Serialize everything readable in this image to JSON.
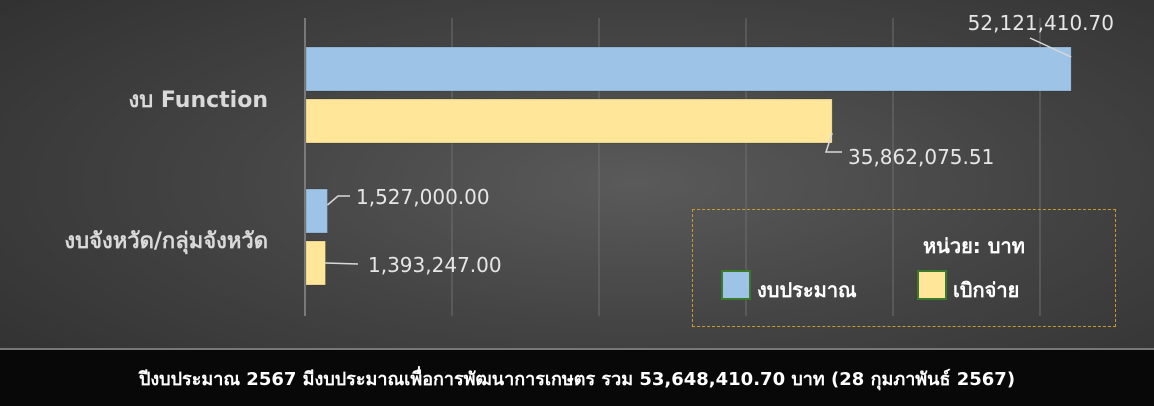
{
  "chart_data": {
    "type": "bar",
    "orientation": "horizontal",
    "categories": [
      "งบ Function",
      "งบจังหวัด/กลุ่มจังหวัด"
    ],
    "series": [
      {
        "name": "งบประมาณ",
        "values": [
          52121410.7,
          1527000.0
        ],
        "labels": [
          "52,121,410.70",
          "1,527,000.00"
        ],
        "color": "#9dc3e6"
      },
      {
        "name": "เบิกจ่าย",
        "values": [
          35862075.51,
          1393247.0
        ],
        "labels": [
          "35,862,075.51",
          "1,393,247.00"
        ],
        "color": "#ffe699"
      }
    ],
    "xlim": [
      0,
      60000000
    ],
    "grid": true,
    "legend_position": "bottom-right",
    "legend_title": "หน่วย: บาท"
  },
  "footer": {
    "text": "ปีงบประมาณ 2567 มีงบประมาณเพื่อการพัฒนาการเกษตร รวม 53,648,410.70 บาท (28 กุมภาพันธ์ 2567)"
  }
}
